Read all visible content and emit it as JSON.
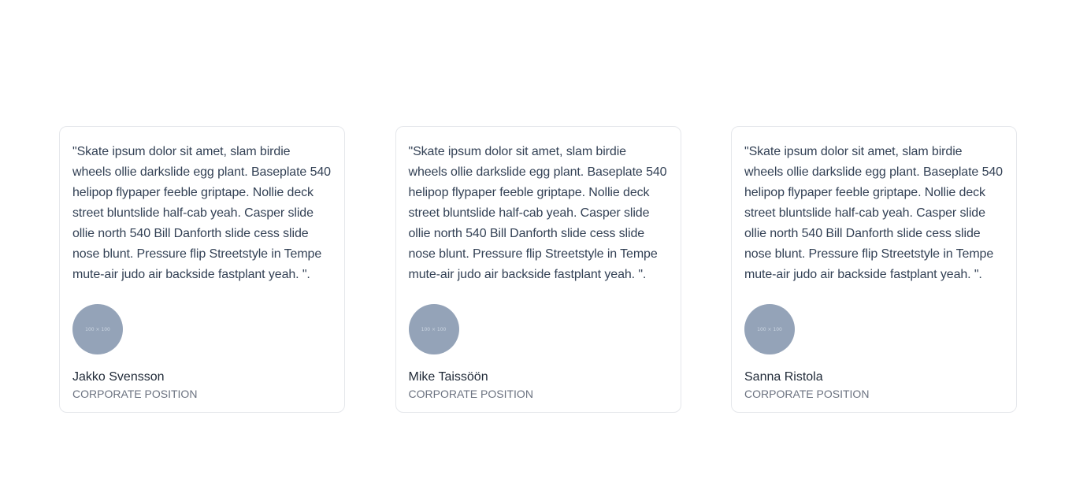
{
  "testimonials": [
    {
      "quote": "\"Skate ipsum dolor sit amet, slam birdie wheels ollie darkslide egg plant. Baseplate 540 helipop flypaper feeble griptape. Nollie deck street bluntslide half-cab yeah. Casper slide ollie north 540 Bill Danforth slide cess slide nose blunt. Pressure flip Streetstyle in Tempe mute-air judo air backside fastplant yeah. \".",
      "avatar_label": "100 × 100",
      "name": "Jakko Svensson",
      "position": "CORPORATE POSITION"
    },
    {
      "quote": "\"Skate ipsum dolor sit amet, slam birdie wheels ollie darkslide egg plant. Baseplate 540 helipop flypaper feeble griptape. Nollie deck street bluntslide half-cab yeah. Casper slide ollie north 540 Bill Danforth slide cess slide nose blunt. Pressure flip Streetstyle in Tempe mute-air judo air backside fastplant yeah. \".",
      "avatar_label": "100 × 100",
      "name": "Mike Taissöön",
      "position": "CORPORATE POSITION"
    },
    {
      "quote": "\"Skate ipsum dolor sit amet, slam birdie wheels ollie darkslide egg plant. Baseplate 540 helipop flypaper feeble griptape. Nollie deck street bluntslide half-cab yeah. Casper slide ollie north 540 Bill Danforth slide cess slide nose blunt. Pressure flip Streetstyle in Tempe mute-air judo air backside fastplant yeah. \".",
      "avatar_label": "100 × 100",
      "name": "Sanna Ristola",
      "position": "CORPORATE POSITION"
    }
  ],
  "colors": {
    "avatar_placeholder": "#94a3b8",
    "card_border": "#e5e7eb",
    "quote_text": "#334155",
    "position_text": "#6b7280"
  }
}
